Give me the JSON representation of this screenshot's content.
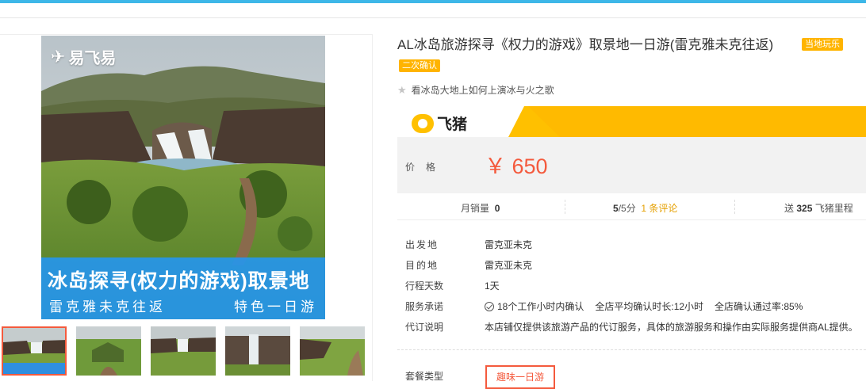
{
  "gallery": {
    "logo_text": "易飞易",
    "banner_title": "冰岛探寻(权力的游戏)取景地",
    "banner_left": "雷克雅未克往返",
    "banner_right": "特色一日游",
    "thumb_count": 5
  },
  "product": {
    "title": "AL冰岛旅游探寻《权力的游戏》取景地一日游(雷克雅未克往返)",
    "badge_local": "当地玩乐",
    "badge_second": "二次确认",
    "subtitle": "看冰岛大地上如何上演冰与火之歌"
  },
  "price_box": {
    "brand": "飞猪",
    "label": "价格",
    "value": "￥ 650"
  },
  "stats": {
    "monthly_label": "月销量",
    "monthly_value": "0",
    "rating_value": "5",
    "rating_unit": "/5分",
    "review_count": "1",
    "review_label": "条评论",
    "miles_prefix": "送",
    "miles_value": "325",
    "miles_label": "飞猪里程"
  },
  "info": {
    "departure_label": "出发地",
    "departure_value": "雷克亚未克",
    "destination_label": "目的地",
    "destination_value": "雷克亚未克",
    "days_label": "行程天数",
    "days_value": "1天",
    "service_label": "服务承诺",
    "service_1": "18个工作小时内确认",
    "service_2": "全店平均确认时长:12小时",
    "service_3": "全店确认通过率:85%",
    "agency_label": "代订说明",
    "agency_value": "本店铺仅提供该旅游产品的代订服务，具体的旅游服务和操作由实际服务提供商AL提供。"
  },
  "package": {
    "label": "套餐类型",
    "option": "趣味一日游"
  },
  "colors": {
    "accent": "#f45a3d",
    "badge": "#ffb400",
    "brand_yellow": "#ffc000",
    "top_bar": "#3db7e8"
  }
}
